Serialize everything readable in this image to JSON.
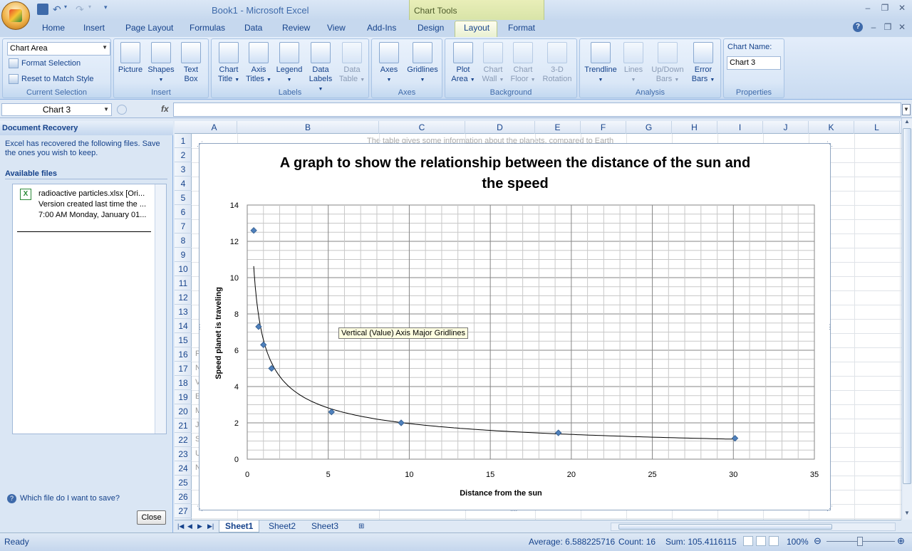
{
  "window": {
    "title": "Book1 - Microsoft Excel",
    "context_tab": "Chart Tools"
  },
  "tabs": [
    "Home",
    "Insert",
    "Page Layout",
    "Formulas",
    "Data",
    "Review",
    "View",
    "Add-Ins",
    "Design",
    "Layout",
    "Format"
  ],
  "ribbon": {
    "current_selection": {
      "dropdown": "Chart Area",
      "format_selection": "Format Selection",
      "reset": "Reset to Match Style",
      "label": "Current Selection"
    },
    "insert": {
      "picture": "Picture",
      "shapes": "Shapes",
      "textbox_1": "Text",
      "textbox_2": "Box",
      "label": "Insert"
    },
    "labels": {
      "chart_title_1": "Chart",
      "chart_title_2": "Title",
      "axis_titles_1": "Axis",
      "axis_titles_2": "Titles",
      "legend_1": "Legend",
      "data_labels_1": "Data",
      "data_labels_2": "Labels",
      "data_table_1": "Data",
      "data_table_2": "Table",
      "label": "Labels"
    },
    "axes": {
      "axes": "Axes",
      "gridlines": "Gridlines",
      "label": "Axes"
    },
    "background": {
      "plot_area_1": "Plot",
      "plot_area_2": "Area",
      "chart_wall_1": "Chart",
      "chart_wall_2": "Wall",
      "chart_floor_1": "Chart",
      "chart_floor_2": "Floor",
      "rotation_1": "3-D",
      "rotation_2": "Rotation",
      "label": "Background"
    },
    "analysis": {
      "trendline": "Trendline",
      "lines": "Lines",
      "updown_1": "Up/Down",
      "updown_2": "Bars",
      "error_1": "Error",
      "error_2": "Bars",
      "label": "Analysis"
    },
    "properties": {
      "chart_name_label": "Chart Name:",
      "chart_name_value": "Chart 3",
      "label": "Properties"
    }
  },
  "formula_bar": {
    "name_box": "Chart 3",
    "fx": "fx",
    "value": ""
  },
  "recovery": {
    "title": "Document Recovery",
    "description": "Excel has recovered the following files.  Save the ones you wish to keep.",
    "available": "Available files",
    "file_line1": "radioactive particles.xlsx  [Ori...",
    "file_line2": "Version created last time the ...",
    "file_line3": "7:00 AM Monday, January 01...",
    "help": "Which file do I want to save?",
    "close": "Close"
  },
  "columns": [
    "A",
    "B",
    "C",
    "D",
    "E",
    "F",
    "G",
    "H",
    "I",
    "J",
    "K",
    "L"
  ],
  "rows": [
    "1",
    "2",
    "3",
    "4",
    "5",
    "6",
    "7",
    "8",
    "9",
    "10",
    "11",
    "12",
    "13",
    "14",
    "15",
    "16",
    "17",
    "18",
    "19",
    "20",
    "21",
    "22",
    "23",
    "24",
    "25",
    "26",
    "27"
  ],
  "cell_fragments": [
    "P",
    "N",
    "V",
    "E",
    "M",
    "J",
    "S",
    "U",
    "N"
  ],
  "hidden_text": "The table gives some information about the planets, compared to Earth",
  "tooltip": "Vertical (Value) Axis Major Gridlines",
  "chart_data": {
    "type": "scatter",
    "title": "A graph to show the relationship between the distance of the sun and the speed",
    "xlabel": "Distance  from the sun",
    "ylabel": "Speed planet  is traveling",
    "xlim": [
      0,
      35
    ],
    "ylim": [
      0,
      14
    ],
    "xticks": [
      "0",
      "5",
      "10",
      "15",
      "20",
      "25",
      "30",
      "35"
    ],
    "yticks": [
      "0",
      "2",
      "4",
      "6",
      "8",
      "10",
      "12",
      "14"
    ],
    "points": [
      {
        "x": 0.4,
        "y": 12.6
      },
      {
        "x": 0.7,
        "y": 7.3
      },
      {
        "x": 1.0,
        "y": 6.3
      },
      {
        "x": 1.5,
        "y": 5.0
      },
      {
        "x": 5.2,
        "y": 2.6
      },
      {
        "x": 9.5,
        "y": 2.0
      },
      {
        "x": 19.2,
        "y": 1.45
      },
      {
        "x": 30.1,
        "y": 1.15
      }
    ],
    "trendline": "power",
    "grid": true,
    "marker_color": "#4f81bd"
  },
  "sheets": [
    "Sheet1",
    "Sheet2",
    "Sheet3"
  ],
  "status": {
    "ready": "Ready",
    "average": "Average: 6.588225716",
    "count": "Count: 16",
    "sum": "Sum: 105.4116115",
    "zoom": "100%"
  }
}
